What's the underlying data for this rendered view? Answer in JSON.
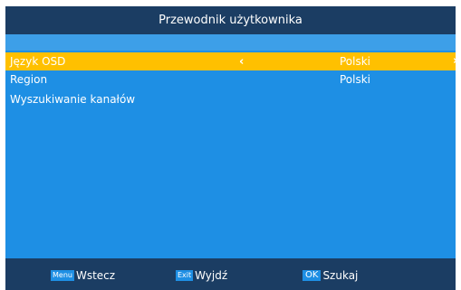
{
  "header": {
    "title": "Przewodnik użytkownika"
  },
  "rows": [
    {
      "label": "Język OSD",
      "value": "Polski",
      "selected": true
    },
    {
      "label": "Region",
      "value": "Polski",
      "selected": false
    },
    {
      "label": "Wyszukiwanie kanałów",
      "value": "",
      "selected": false
    }
  ],
  "arrows": {
    "left": "‹",
    "right": "›"
  },
  "footer": {
    "menu": {
      "key": "Menu",
      "label": "Wstecz"
    },
    "exit": {
      "key": "Exit",
      "label": "Wyjdź"
    },
    "ok": {
      "key": "OK",
      "label": "Szukaj"
    }
  },
  "colors": {
    "header_bg": "#1b3d63",
    "content_bg": "#1e8fe4",
    "highlight": "#ffc000"
  }
}
